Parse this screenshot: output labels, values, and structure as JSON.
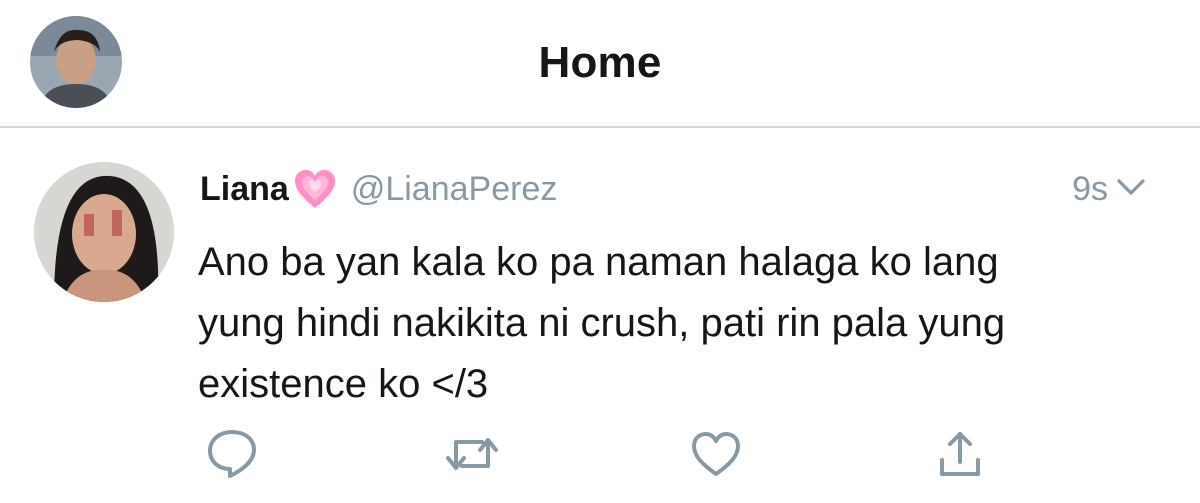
{
  "header": {
    "title": "Home",
    "avatar_icon": "profile-avatar"
  },
  "tweet": {
    "display_name": "Liana",
    "name_emoji": "pink-heart-emoji",
    "handle": "@LianaPerez",
    "time": "9s",
    "text": "Ano ba yan kala ko pa naman halaga ko lang\nyung hindi nakikita ni crush, pati rin pala yung\nexistence ko </3",
    "avatar_icon": "author-avatar"
  },
  "actions": [
    {
      "name": "reply-icon"
    },
    {
      "name": "retweet-icon"
    },
    {
      "name": "like-icon"
    },
    {
      "name": "share-icon"
    }
  ],
  "colors": {
    "text": "#14171a",
    "secondary": "#8899a6",
    "divider": "#d5d8db",
    "heart": "#ff7fbf"
  }
}
